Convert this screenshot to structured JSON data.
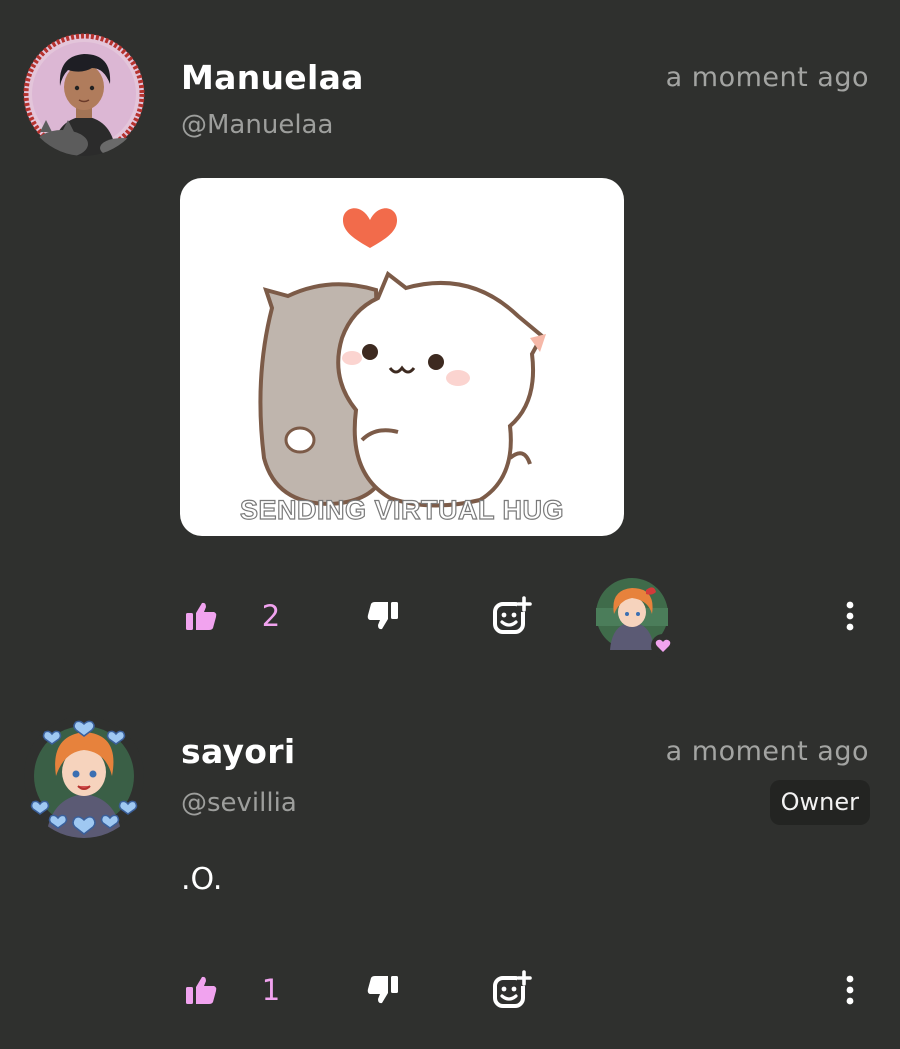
{
  "colors": {
    "background": "#2f302e",
    "accent_pink": "#f1a3ef",
    "muted_text": "#9d9e9c",
    "badge_bg": "#232422"
  },
  "comments": [
    {
      "display_name": "Manuelaa",
      "handle": "@Manuelaa",
      "timestamp": "a moment ago",
      "attachment": {
        "type": "gif",
        "caption": "SENDING VIRTUAL HUG"
      },
      "likes": "2",
      "reaction": {
        "icon": "heart-icon"
      }
    },
    {
      "display_name": "sayori",
      "handle": "@sevillia",
      "timestamp": "a moment ago",
      "badge": "Owner",
      "text": ".O.",
      "likes": "1"
    }
  ],
  "icons": {
    "like": "thumbs-up-icon",
    "dislike": "thumbs-down-icon",
    "add_reaction": "add-reaction-icon",
    "more": "more-vertical-icon"
  }
}
